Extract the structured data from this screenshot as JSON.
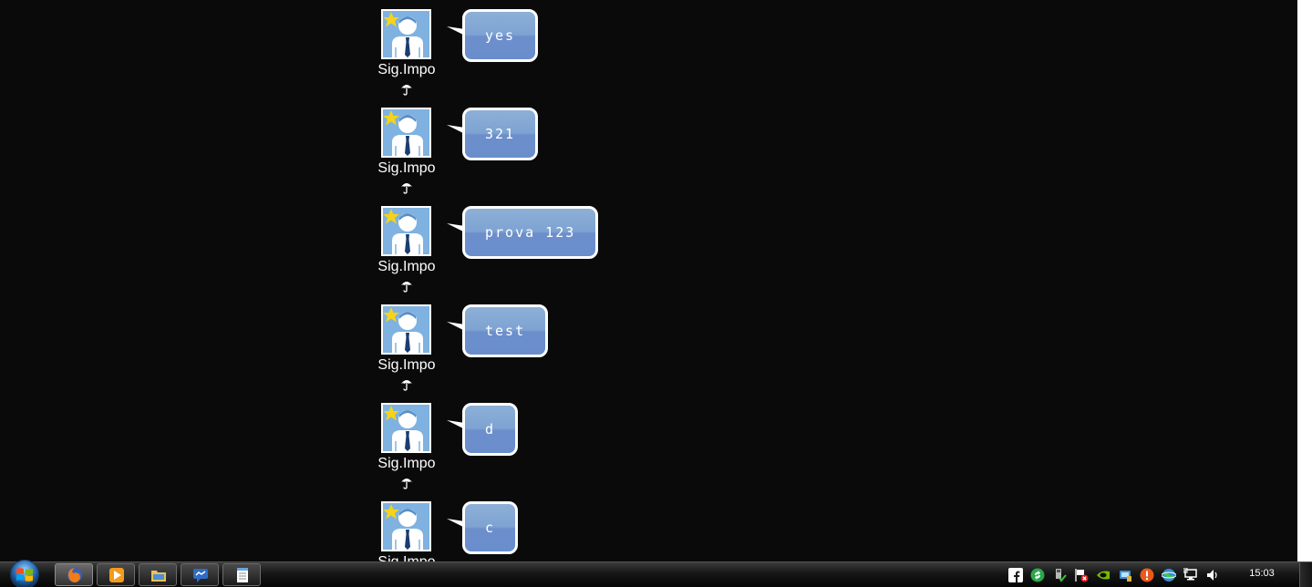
{
  "chat": {
    "messages": [
      {
        "user": "Sig.Impo",
        "text": "yes"
      },
      {
        "user": "Sig.Impo",
        "text": "321"
      },
      {
        "user": "Sig.Impo",
        "text": "prova 123"
      },
      {
        "user": "Sig.Impo",
        "text": "test"
      },
      {
        "user": "Sig.Impo",
        "text": "d"
      },
      {
        "user": "Sig.Impo",
        "text": "c"
      }
    ]
  },
  "taskbar": {
    "buttons": [
      "firefox-icon",
      "media-player-icon",
      "file-explorer-icon",
      "messenger-icon",
      "notepad-icon"
    ],
    "tray_icons": [
      "facebook-icon",
      "update-icon",
      "usb-safe-remove-icon",
      "action-center-flag-icon",
      "nvidia-icon",
      "device-icon",
      "alert-icon",
      "network-globe-icon",
      "network-monitor-icon",
      "volume-icon"
    ],
    "clock": "15:03"
  },
  "colors": {
    "background": "#0a0a0a",
    "bubble_top": "#8db0d7",
    "bubble_bottom": "#6a8ecc",
    "avatar_bg": "#7fb2e0",
    "star": "#f4d31a"
  }
}
